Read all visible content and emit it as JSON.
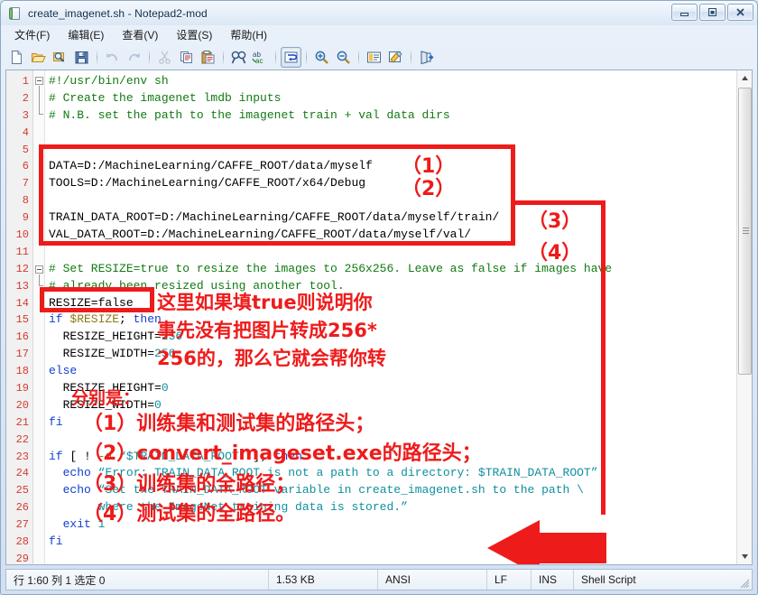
{
  "window": {
    "title": "create_imagenet.sh - Notepad2-mod",
    "icon": "document-icon",
    "controls": [
      {
        "name": "minimize",
        "glyph": "minimize-icon"
      },
      {
        "name": "restore",
        "glyph": "restore-icon"
      },
      {
        "name": "close",
        "glyph": "close-icon"
      }
    ]
  },
  "menu": [
    {
      "label": "文件(F)",
      "name": "menu-file"
    },
    {
      "label": "编辑(E)",
      "name": "menu-edit"
    },
    {
      "label": "查看(V)",
      "name": "menu-view"
    },
    {
      "label": "设置(S)",
      "name": "menu-settings"
    },
    {
      "label": "帮助(H)",
      "name": "menu-help"
    }
  ],
  "toolbar": [
    {
      "name": "new-file-icon",
      "kind": "btn",
      "enabled": true
    },
    {
      "name": "open-file-icon",
      "kind": "btn",
      "enabled": true
    },
    {
      "name": "browse-file-icon",
      "kind": "btn",
      "enabled": true
    },
    {
      "name": "save-file-icon",
      "kind": "btn",
      "enabled": true
    },
    {
      "name": "separator-1",
      "kind": "sep",
      "enabled": true
    },
    {
      "name": "undo-icon",
      "kind": "btn",
      "enabled": false
    },
    {
      "name": "redo-icon",
      "kind": "btn",
      "enabled": false
    },
    {
      "name": "separator-2",
      "kind": "sep",
      "enabled": true
    },
    {
      "name": "cut-icon",
      "kind": "btn",
      "enabled": false
    },
    {
      "name": "copy-icon",
      "kind": "btn",
      "enabled": true
    },
    {
      "name": "paste-icon",
      "kind": "btn",
      "enabled": true
    },
    {
      "name": "separator-3",
      "kind": "sep",
      "enabled": true
    },
    {
      "name": "find-icon",
      "kind": "btn",
      "enabled": true
    },
    {
      "name": "replace-icon",
      "kind": "btn",
      "enabled": true
    },
    {
      "name": "separator-4",
      "kind": "sep",
      "enabled": true
    },
    {
      "name": "word-wrap-icon",
      "kind": "btn",
      "enabled": true,
      "active": true
    },
    {
      "name": "separator-5",
      "kind": "sep",
      "enabled": true
    },
    {
      "name": "zoom-in-icon",
      "kind": "btn",
      "enabled": true
    },
    {
      "name": "zoom-out-icon",
      "kind": "btn",
      "enabled": true
    },
    {
      "name": "separator-6",
      "kind": "sep",
      "enabled": true
    },
    {
      "name": "scheme-icon",
      "kind": "btn",
      "enabled": true
    },
    {
      "name": "customize-icon",
      "kind": "btn",
      "enabled": true
    },
    {
      "name": "separator-7",
      "kind": "sep",
      "enabled": true
    },
    {
      "name": "exit-icon",
      "kind": "btn",
      "enabled": true
    }
  ],
  "editor": {
    "first_line": 1,
    "last_line": 29,
    "lines": [
      {
        "n": 1,
        "segments": [
          {
            "t": "#!/usr/bin/env sh",
            "c": "cmt"
          }
        ]
      },
      {
        "n": 2,
        "segments": [
          {
            "t": "# Create the imagenet lmdb inputs",
            "c": "cmt"
          }
        ]
      },
      {
        "n": 3,
        "segments": [
          {
            "t": "# N.B. set the path to the imagenet train + val data dirs",
            "c": "cmt"
          }
        ]
      },
      {
        "n": 4,
        "segments": []
      },
      {
        "n": 5,
        "segments": []
      },
      {
        "n": 6,
        "segments": [
          {
            "t": "DATA=D:/MachineLearning/CAFFE_ROOT/data/myself",
            "c": ""
          }
        ]
      },
      {
        "n": 7,
        "segments": [
          {
            "t": "TOOLS=D:/MachineLearning/CAFFE_ROOT/x64/Debug",
            "c": ""
          }
        ]
      },
      {
        "n": 8,
        "segments": []
      },
      {
        "n": 9,
        "segments": [
          {
            "t": "TRAIN_DATA_ROOT=D:/MachineLearning/CAFFE_ROOT/data/myself/train/",
            "c": ""
          }
        ]
      },
      {
        "n": 10,
        "segments": [
          {
            "t": "VAL_DATA_ROOT=D:/MachineLearning/CAFFE_ROOT/data/myself/val/",
            "c": ""
          }
        ]
      },
      {
        "n": 11,
        "segments": []
      },
      {
        "n": 12,
        "segments": [
          {
            "t": "# Set RESIZE=true to resize the images to 256x256. Leave as false if images have",
            "c": "cmt"
          }
        ]
      },
      {
        "n": 13,
        "segments": [
          {
            "t": "# already been resized using another tool.",
            "c": "cmt"
          }
        ]
      },
      {
        "n": 14,
        "segments": [
          {
            "t": "RESIZE=false",
            "c": ""
          }
        ]
      },
      {
        "n": 15,
        "segments": [
          {
            "t": "if ",
            "c": "kw"
          },
          {
            "t": "$RESIZE",
            "c": "var"
          },
          {
            "t": "; ",
            "c": ""
          },
          {
            "t": "then",
            "c": "kw"
          }
        ]
      },
      {
        "n": 16,
        "segments": [
          {
            "t": "  RESIZE_HEIGHT=",
            "c": ""
          },
          {
            "t": "256",
            "c": "num"
          }
        ]
      },
      {
        "n": 17,
        "segments": [
          {
            "t": "  RESIZE_WIDTH=",
            "c": ""
          },
          {
            "t": "256",
            "c": "num"
          }
        ]
      },
      {
        "n": 18,
        "segments": [
          {
            "t": "else",
            "c": "kw"
          }
        ]
      },
      {
        "n": 19,
        "segments": [
          {
            "t": "  RESIZE_HEIGHT=",
            "c": ""
          },
          {
            "t": "0",
            "c": "num"
          }
        ]
      },
      {
        "n": 20,
        "segments": [
          {
            "t": "  RESIZE_WIDTH=",
            "c": ""
          },
          {
            "t": "0",
            "c": "num"
          }
        ]
      },
      {
        "n": 21,
        "segments": [
          {
            "t": "fi",
            "c": "kw"
          }
        ]
      },
      {
        "n": 22,
        "segments": []
      },
      {
        "n": 23,
        "segments": [
          {
            "t": "if",
            "c": "kw"
          },
          {
            "t": " [ ! ",
            "c": ""
          },
          {
            "t": "-d",
            "c": "var"
          },
          {
            "t": " ",
            "c": ""
          },
          {
            "t": "“$TRAIN_DATA_ROOT”",
            "c": "str"
          },
          {
            "t": " ]; ",
            "c": ""
          },
          {
            "t": "then",
            "c": "kw"
          }
        ]
      },
      {
        "n": 24,
        "segments": [
          {
            "t": "  ",
            "c": ""
          },
          {
            "t": "echo",
            "c": "kw"
          },
          {
            "t": " ",
            "c": ""
          },
          {
            "t": "“Error: TRAIN_DATA_ROOT is not a path to a directory: $TRAIN_DATA_ROOT”",
            "c": "str"
          }
        ]
      },
      {
        "n": 25,
        "segments": [
          {
            "t": "  ",
            "c": ""
          },
          {
            "t": "echo",
            "c": "kw"
          },
          {
            "t": " ",
            "c": ""
          },
          {
            "t": "“Set the TRAIN_DATA_ROOT variable in create_imagenet.sh to the path \\",
            "c": "str"
          }
        ]
      },
      {
        "n": 26,
        "segments": [
          {
            "t": "       where the ImageNet training data is stored.”",
            "c": "str"
          }
        ]
      },
      {
        "n": 27,
        "segments": [
          {
            "t": "  ",
            "c": ""
          },
          {
            "t": "exit",
            "c": "kw"
          },
          {
            "t": " ",
            "c": ""
          },
          {
            "t": "1",
            "c": "num"
          }
        ]
      },
      {
        "n": 28,
        "segments": [
          {
            "t": "fi",
            "c": "kw"
          }
        ]
      },
      {
        "n": 29,
        "segments": []
      }
    ]
  },
  "annotations": {
    "color": "#ee1b1b",
    "labels": [
      {
        "name": "callout-1",
        "text": "（1）"
      },
      {
        "name": "callout-2",
        "text": "（2）"
      },
      {
        "name": "callout-3",
        "text": "（3）"
      },
      {
        "name": "callout-4",
        "text": "（4）"
      }
    ],
    "note_top": [
      "这里如果填true则说明你",
      "事先没有把图片转成256*",
      "256的，那么它就会帮你转"
    ],
    "note_bottom": [
      "分别是：",
      "（1）训练集和测试集的路径头；",
      "（2）convert_imageset.exe的路径头；",
      "（3）训练集的全路径；",
      "（4）测试集的全路径。"
    ]
  },
  "statusbar": {
    "position": "行 1:60  列 1  选定 0",
    "size": "1.53 KB",
    "encoding": "ANSI",
    "lineending": "LF",
    "insertmode": "INS",
    "language": "Shell Script"
  }
}
